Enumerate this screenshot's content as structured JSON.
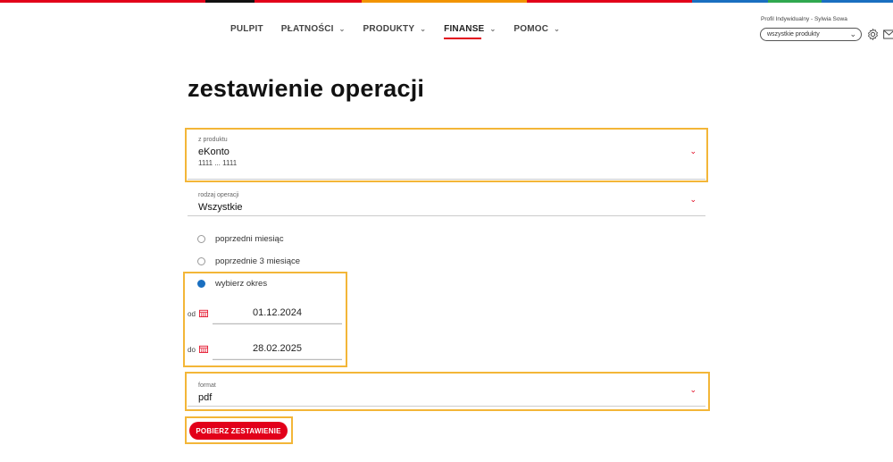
{
  "colors": {
    "accent": "#e2001a",
    "highlight": "#f3b638",
    "radio_selected": "#1a6fc0"
  },
  "top_stripe": [
    "#e2001a",
    "#111111",
    "#e2001a",
    "#f29400",
    "#e2001a",
    "#1a6fc0",
    "#2fa84f",
    "#1a6fc0"
  ],
  "nav": {
    "items": [
      {
        "label": "PULPIT",
        "has_menu": false,
        "active": false
      },
      {
        "label": "PŁATNOŚCI",
        "has_menu": true,
        "active": false
      },
      {
        "label": "PRODUKTY",
        "has_menu": true,
        "active": false
      },
      {
        "label": "FINANSE",
        "has_menu": true,
        "active": true
      },
      {
        "label": "POMOC",
        "has_menu": true,
        "active": false
      }
    ]
  },
  "header": {
    "profile_text": "Profil Indywidualny - Sylwia Sowa",
    "product_filter": "wszystkie produkty",
    "icons": [
      "gear-icon",
      "mail-icon"
    ]
  },
  "page": {
    "title": "zestawienie operacji"
  },
  "form": {
    "product": {
      "label": "z produktu",
      "value": "eKonto",
      "account": "1111 ... 1111"
    },
    "operation_type": {
      "label": "rodzaj operacji",
      "value": "Wszystkie"
    },
    "period_options": [
      {
        "label": "poprzedni miesiąc",
        "selected": false
      },
      {
        "label": "poprzednie 3 miesiące",
        "selected": false
      },
      {
        "label": "wybierz okres",
        "selected": true
      }
    ],
    "date_from": {
      "label": "od",
      "value": "01.12.2024"
    },
    "date_to": {
      "label": "do",
      "value": "28.02.2025"
    },
    "format": {
      "label": "format",
      "value": "pdf"
    },
    "submit_label": "POBIERZ ZESTAWIENIE"
  }
}
